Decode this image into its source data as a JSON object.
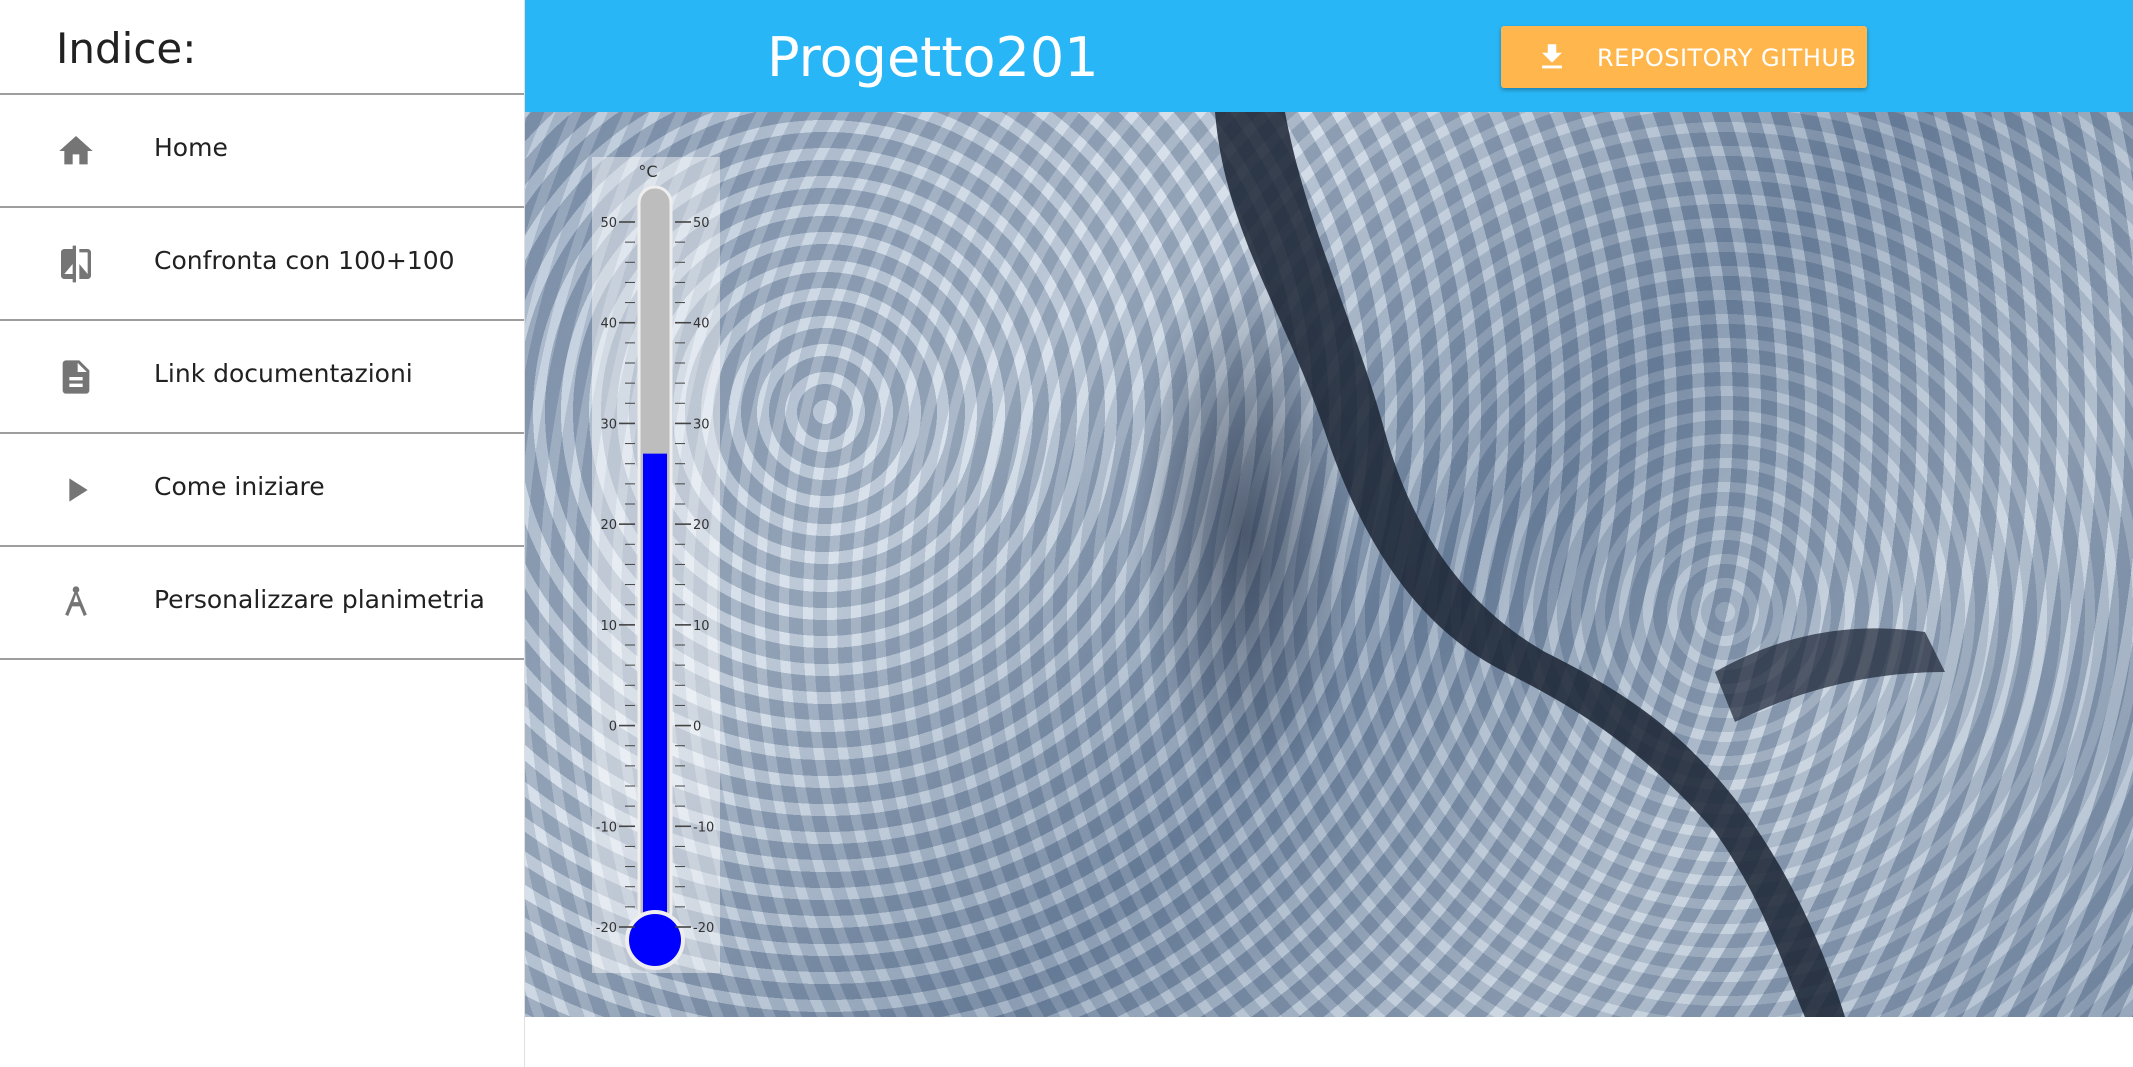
{
  "sidebar": {
    "title": "Indice:",
    "items": [
      {
        "label": "Home",
        "icon": "home-icon"
      },
      {
        "label": "Confronta con 100+100",
        "icon": "compare-icon"
      },
      {
        "label": "Link documentazioni",
        "icon": "document-icon"
      },
      {
        "label": "Come iniziare",
        "icon": "play-icon"
      },
      {
        "label": "Personalizzare planimetria",
        "icon": "compass-icon"
      }
    ]
  },
  "header": {
    "title": "Progetto201",
    "github_button": {
      "label": "REPOSITORY GITHUB",
      "icon": "download-icon"
    }
  },
  "thermometer": {
    "unit": "°C",
    "ticks": [
      "50",
      "40",
      "30",
      "20",
      "10",
      "0",
      "-10",
      "-20"
    ],
    "min": -20,
    "max": 50,
    "value": 27
  },
  "colors": {
    "appbar": "#29b6f6",
    "button": "#ffb74d",
    "mercury": "#0000ff",
    "icon": "#757575"
  }
}
